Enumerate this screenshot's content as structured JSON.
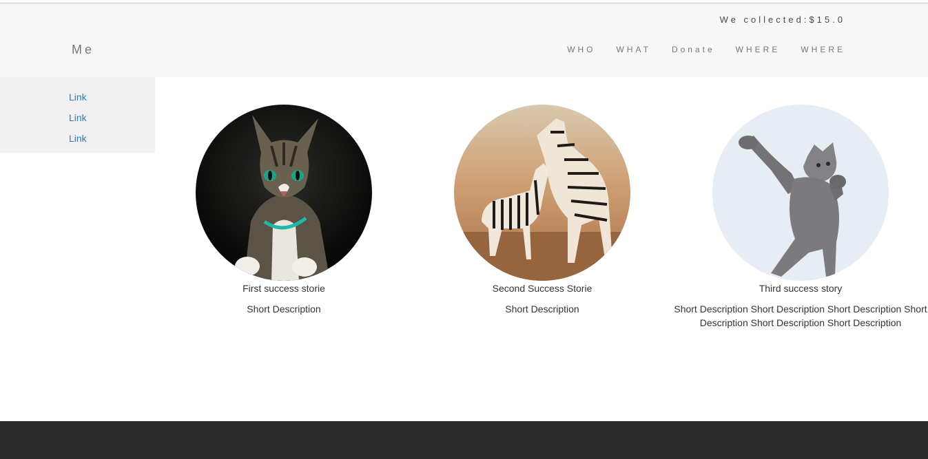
{
  "header": {
    "collected_text": "We collected:$15.0",
    "brand": "Me",
    "nav": [
      "WHO",
      "WHAT",
      "Donate",
      "WHERE",
      "WHERE"
    ]
  },
  "sidenav": {
    "links": [
      "Link",
      "Link",
      "Link"
    ]
  },
  "stories": [
    {
      "image": "cat-photo",
      "title": "First success storie",
      "description": "Short Description"
    },
    {
      "image": "zebras-photo",
      "title": "Second Success Storie",
      "description": "Short Description"
    },
    {
      "image": "dancing-cat-photo",
      "title": "Third success story",
      "description": "Short Description Short Description Short Description Short Description Short Description Short Description"
    }
  ],
  "colors": {
    "header_bg": "#f7f7f7",
    "sidenav_bg": "#f1f1f1",
    "link": "#337ab7",
    "footer_bg": "#2b2b2b"
  }
}
